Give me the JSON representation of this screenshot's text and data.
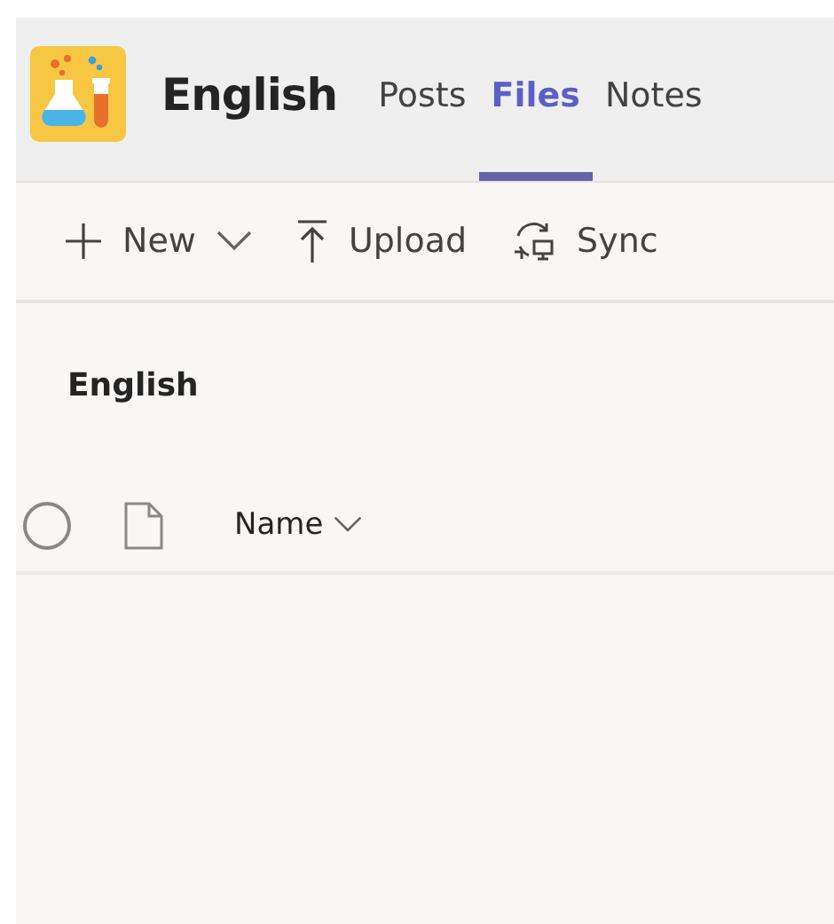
{
  "team": {
    "name": "English"
  },
  "tabs": [
    {
      "label": "Posts",
      "selected": false
    },
    {
      "label": "Files",
      "selected": true
    },
    {
      "label": "Notes",
      "selected": false
    }
  ],
  "toolbar": [
    {
      "kind": "new",
      "label": "New"
    },
    {
      "kind": "upload",
      "label": "Upload"
    },
    {
      "kind": "sync",
      "label": "Sync"
    }
  ],
  "breadcrumb": "English",
  "table": {
    "select_all": {
      "checked": false
    },
    "columns": [
      {
        "label": "Name"
      }
    ]
  }
}
